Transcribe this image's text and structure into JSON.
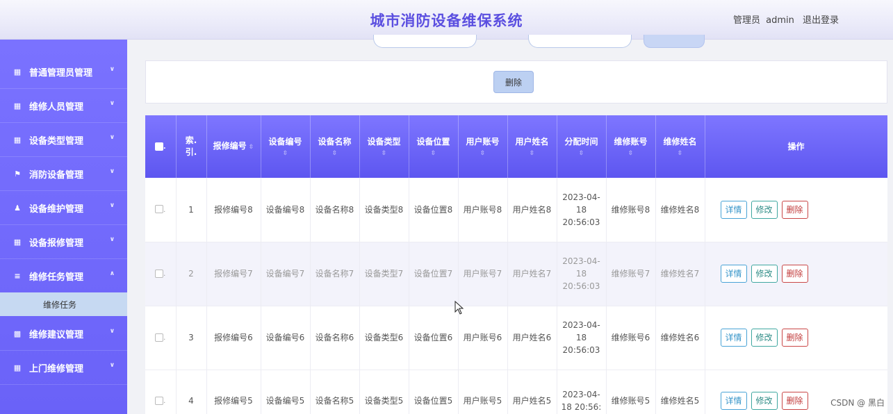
{
  "header": {
    "title": "城市消防设备维保系统",
    "role": "管理员",
    "username": "admin",
    "logout": "退出登录"
  },
  "sidebar": {
    "items": [
      {
        "label": "普通管理员管理",
        "icon": "grid-icon",
        "expanded": false
      },
      {
        "label": "维修人员管理",
        "icon": "grid-icon",
        "expanded": false
      },
      {
        "label": "设备类型管理",
        "icon": "grid-icon",
        "expanded": false
      },
      {
        "label": "消防设备管理",
        "icon": "flag-icon",
        "expanded": false
      },
      {
        "label": "设备维护管理",
        "icon": "user-icon",
        "expanded": false
      },
      {
        "label": "设备报修管理",
        "icon": "grid-icon",
        "expanded": false
      },
      {
        "label": "维修任务管理",
        "icon": "sliders-icon",
        "expanded": true
      },
      {
        "label": "维修建议管理",
        "icon": "briefcase-icon",
        "expanded": false
      },
      {
        "label": "上门维修管理",
        "icon": "grid-icon",
        "expanded": false
      }
    ],
    "submenu": {
      "label": "维修任务"
    }
  },
  "actions": {
    "delete_label": "删除"
  },
  "table": {
    "columns": {
      "index": "索.\n引.",
      "repair_no": "报修编号",
      "device_no": "设备编号",
      "device_name": "设备名称",
      "device_type": "设备类型",
      "device_location": "设备位置",
      "user_account": "用户账号",
      "user_name": "用户姓名",
      "assign_time": "分配时间",
      "repair_account": "维修账号",
      "repair_name": "维修姓名",
      "ops": "操作"
    },
    "rows": [
      {
        "index": "1",
        "repair_no": "报修编号8",
        "device_no": "设备编号8",
        "device_name": "设备名称8",
        "device_type": "设备类型8",
        "device_location": "设备位置8",
        "user_account": "用户账号8",
        "user_name": "用户姓名8",
        "assign_time": "2023-04-18 20:56:03",
        "repair_account": "维修账号8",
        "repair_name": "维修姓名8"
      },
      {
        "index": "2",
        "repair_no": "报修编号7",
        "device_no": "设备编号7",
        "device_name": "设备名称7",
        "device_type": "设备类型7",
        "device_location": "设备位置7",
        "user_account": "用户账号7",
        "user_name": "用户姓名7",
        "assign_time": "2023-04-18 20:56:03",
        "repair_account": "维修账号7",
        "repair_name": "维修姓名7"
      },
      {
        "index": "3",
        "repair_no": "报修编号6",
        "device_no": "设备编号6",
        "device_name": "设备名称6",
        "device_type": "设备类型6",
        "device_location": "设备位置6",
        "user_account": "用户账号6",
        "user_name": "用户姓名6",
        "assign_time": "2023-04-18 20:56:03",
        "repair_account": "维修账号6",
        "repair_name": "维修姓名6"
      },
      {
        "index": "4",
        "repair_no": "报修编号5",
        "device_no": "设备编号5",
        "device_name": "设备名称5",
        "device_type": "设备类型5",
        "device_location": "设备位置5",
        "user_account": "用户账号5",
        "user_name": "用户姓名5",
        "assign_time": "2023-04-18 20:56:",
        "repair_account": "维修账号5",
        "repair_name": "维修姓名5"
      }
    ],
    "row_buttons": {
      "detail": "详情",
      "edit": "修改",
      "delete": "删除"
    }
  },
  "watermark": "CSDN @ 黑白",
  "colors": {
    "accent": "#6a62f8",
    "title": "#5b4fe0",
    "submenu": "#c6d9f2"
  }
}
